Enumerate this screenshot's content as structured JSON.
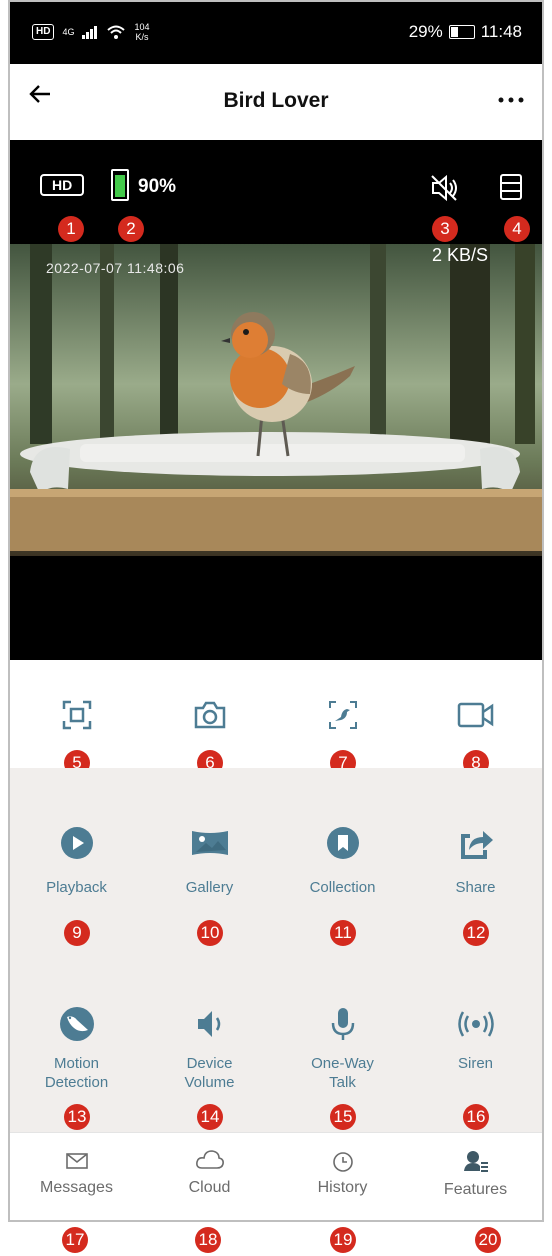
{
  "status_bar": {
    "hd": "HD",
    "signal": "4G",
    "speed_value": "104",
    "speed_unit": "K/s",
    "battery": "29%",
    "time": "11:48"
  },
  "header": {
    "title": "Bird Lover",
    "back_icon": "arrow-left-icon",
    "more_icon": "more-dots-icon"
  },
  "video": {
    "quality": "HD",
    "battery": "90%",
    "battery_level": 0.9,
    "battery_color": "#43c94a",
    "speed": "2 KB/S",
    "timestamp": "2022-07-07   11:48:06"
  },
  "controls": [
    {
      "icon": "fullscreen-icon",
      "marker": "5"
    },
    {
      "icon": "camera-icon",
      "marker": "6"
    },
    {
      "icon": "bird-identify-icon",
      "marker": "7"
    },
    {
      "icon": "video-record-icon",
      "marker": "8"
    }
  ],
  "features": [
    {
      "label": "Playback",
      "icon": "play-icon",
      "marker": "9"
    },
    {
      "label": "Gallery",
      "icon": "image-icon",
      "marker": "10"
    },
    {
      "label": "Collection",
      "icon": "bookmark-icon",
      "marker": "11"
    },
    {
      "label": "Share",
      "icon": "share-icon",
      "marker": "12"
    },
    {
      "label": "Motion\nDetection",
      "icon": "motion-bird-icon",
      "marker": "13"
    },
    {
      "label": "Device\nVolume",
      "icon": "volume-icon",
      "marker": "14"
    },
    {
      "label": "One-Way\nTalk",
      "icon": "microphone-icon",
      "marker": "15"
    },
    {
      "label": "Siren",
      "icon": "siren-icon",
      "marker": "16"
    }
  ],
  "tabs": [
    {
      "label": "Messages",
      "icon": "envelope-icon",
      "marker": "17"
    },
    {
      "label": "Cloud",
      "icon": "cloud-icon",
      "marker": "18"
    },
    {
      "label": "History",
      "icon": "clock-icon",
      "marker": "19"
    },
    {
      "label": "Features",
      "icon": "person-list-icon",
      "marker": "20"
    }
  ],
  "markers": {
    "top": [
      "1",
      "2",
      "3",
      "4"
    ]
  },
  "colors": {
    "accent": "#4d7c93",
    "marker": "#d42a1e",
    "grid_bg": "#f1eeec"
  }
}
